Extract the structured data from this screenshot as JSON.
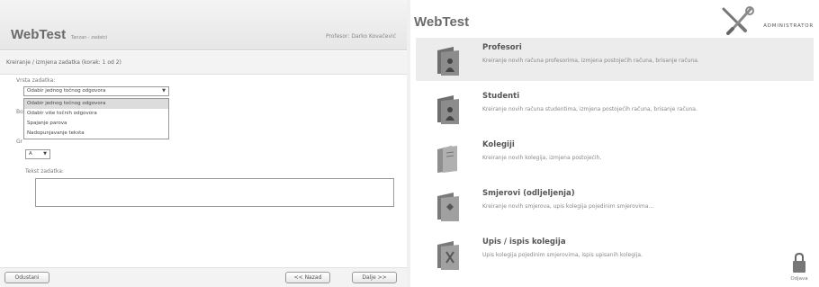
{
  "left": {
    "logo": "WebTest",
    "task_label": "Tanzan - zadatci",
    "professor": "Profesor: Darko Kovačević",
    "subheader": "Kreiranje / izmjena zadatka  (korak: 1 od 2)",
    "vrsta_label": "Vrsta zadatka:",
    "vrsta_value": "Odabir jednog točnog odgovora",
    "dropdown_options": [
      "Odabir jednog točnog odgovora",
      "Odabir više točnih odgovora",
      "Spajanje parova",
      "Nadopunjavanje teksta"
    ],
    "bo_label": "Bo",
    "gr_label": "Gr",
    "grade_value": "A",
    "tekst_label": "Tekst zadatka:",
    "cancel": "Odustani",
    "back": "<< Nazad",
    "next": "Dalje >>"
  },
  "right": {
    "logo": "WebTest",
    "admin": "ADMINISTRATOR",
    "items": [
      {
        "title": "Profesori",
        "desc": "Kreiranje novih računa profesorima, izmjena postojećih računa, brisanje računa."
      },
      {
        "title": "Studenti",
        "desc": "Kreiranje novih računa studentima, izmjena postojećih računa, brisanje računa."
      },
      {
        "title": "Kolegiji",
        "desc": "Kreiranje novih kolegija, izmjena postojećih."
      },
      {
        "title": "Smjerovi (odljeljenja)",
        "desc": "Kreiranje novih smjerova, upis kolegija pojedinim smjerovima..."
      },
      {
        "title": "Upis / ispis kolegija",
        "desc": "Upis kolegija pojedinim smjerovima, ispis upisanih kolegija."
      }
    ],
    "logout": "Odjava"
  }
}
